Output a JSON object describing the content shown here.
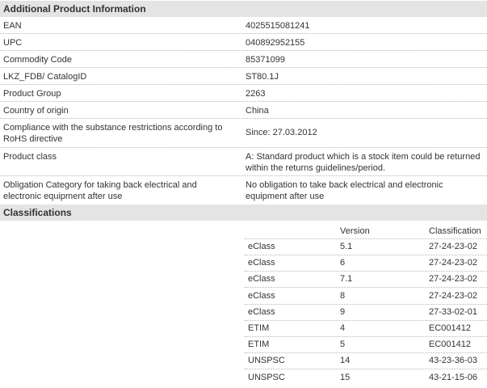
{
  "additional_info": {
    "title": "Additional Product Information",
    "rows": [
      {
        "label": "EAN",
        "value": "4025515081241"
      },
      {
        "label": "UPC",
        "value": "040892952155"
      },
      {
        "label": "Commodity Code",
        "value": "85371099"
      },
      {
        "label": "LKZ_FDB/ CatalogID",
        "value": "ST80.1J"
      },
      {
        "label": "Product Group",
        "value": "2263"
      },
      {
        "label": "Country of origin",
        "value": "China"
      },
      {
        "label": "Compliance with the substance restrictions according to RoHS directive",
        "value": "Since: 27.03.2012"
      },
      {
        "label": "Product class",
        "value": "A: Standard product which is a stock item could be returned within the returns guidelines/period."
      },
      {
        "label": "Obligation Category for taking back electrical and electronic equipment after use",
        "value": "No obligation to take back electrical and electronic equipment after use"
      }
    ]
  },
  "classifications": {
    "title": "Classifications",
    "headers": {
      "system": "",
      "version": "Version",
      "classification": "Classification"
    },
    "rows": [
      {
        "system": "eClass",
        "version": "5.1",
        "classification": "27-24-23-02"
      },
      {
        "system": "eClass",
        "version": "6",
        "classification": "27-24-23-02"
      },
      {
        "system": "eClass",
        "version": "7.1",
        "classification": "27-24-23-02"
      },
      {
        "system": "eClass",
        "version": "8",
        "classification": "27-24-23-02"
      },
      {
        "system": "eClass",
        "version": "9",
        "classification": "27-33-02-01"
      },
      {
        "system": "ETIM",
        "version": "4",
        "classification": "EC001412"
      },
      {
        "system": "ETIM",
        "version": "5",
        "classification": "EC001412"
      },
      {
        "system": "UNSPSC",
        "version": "14",
        "classification": "43-23-36-03"
      },
      {
        "system": "UNSPSC",
        "version": "15",
        "classification": "43-21-15-06"
      }
    ]
  }
}
